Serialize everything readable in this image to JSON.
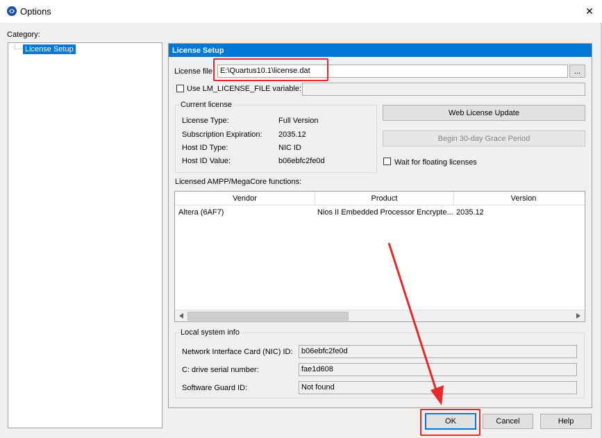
{
  "window": {
    "title": "Options",
    "close_glyph": "✕"
  },
  "category": {
    "label": "Category:",
    "items": [
      {
        "label": "License Setup",
        "selected": true
      }
    ]
  },
  "license_setup": {
    "header": "License Setup",
    "license_file_label": "License file:",
    "license_file_value": "E:\\Quartus10.1\\license.dat",
    "browse_label": "...",
    "use_lm_label": "Use LM_LICENSE_FILE variable:",
    "use_lm_checked": false,
    "lm_value": "",
    "current_license": {
      "title": "Current license",
      "rows": [
        {
          "label": "License Type:",
          "value": "Full Version"
        },
        {
          "label": "Subscription Expiration:",
          "value": "2035.12"
        },
        {
          "label": "Host ID Type:",
          "value": "NIC ID"
        },
        {
          "label": "Host ID Value:",
          "value": "b06ebfc2fe0d"
        }
      ]
    },
    "web_update_label": "Web License Update",
    "grace_period_label": "Begin 30-day Grace Period",
    "wait_floating_label": "Wait for floating licenses",
    "wait_floating_checked": false,
    "ampp_label": "Licensed AMPP/MegaCore functions:",
    "table": {
      "columns": [
        "Vendor",
        "Product",
        "Version"
      ],
      "rows": [
        [
          "Altera (6AF7)",
          "Nios II Embedded Processor Encrypte...",
          "2035.12"
        ]
      ]
    },
    "local_info": {
      "title": "Local system info",
      "rows": [
        {
          "label": "Network Interface Card (NIC) ID:",
          "value": "b06ebfc2fe0d"
        },
        {
          "label": "C: drive serial number:",
          "value": "fae1d608"
        },
        {
          "label": "Software Guard ID:",
          "value": "Not found"
        }
      ]
    }
  },
  "buttons": {
    "ok": "OK",
    "cancel": "Cancel",
    "help": "Help"
  },
  "annotation": {
    "color": "#e8292a"
  },
  "colors": {
    "accent": "#0078d7"
  },
  "icons": [
    "app-icon",
    "close-icon",
    "scroll-left-icon",
    "scroll-right-icon",
    "annotation-arrow"
  ]
}
